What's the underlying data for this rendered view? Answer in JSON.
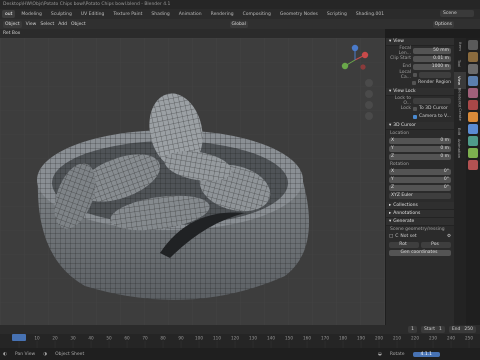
{
  "titlebar": {
    "text": "Desktop\\HW\\Objs\\Potato Chips bowl\\Potato Chips bowl.blend - Blender 4.1"
  },
  "workspaces": [
    "Layout",
    "Modeling",
    "Sculpting",
    "UV Editing",
    "Texture Paint",
    "Shading",
    "Animation",
    "Rendering",
    "Compositing",
    "Geometry Nodes",
    "Scripting",
    "Shading.001"
  ],
  "workspaces_prefix": "out",
  "scene": {
    "label": "Scene"
  },
  "header": {
    "mode": "Object",
    "items": [
      "View",
      "Select",
      "Add",
      "Object"
    ],
    "transform": "Global",
    "options": "Options"
  },
  "tool_header": {
    "items": [
      "Ret Box"
    ]
  },
  "sidebar_tabs": [
    "Item",
    "Tool",
    "View",
    "BlenderKit",
    "Create",
    "Edit",
    "Animation"
  ],
  "sidebar_tab_active": "View",
  "panel": {
    "view_section": "View",
    "focal_label": "Focal Len...",
    "focal_value": "50 mm",
    "clip_start_label": "Clip Start",
    "clip_start_value": "0.01 m",
    "clip_end_label": "End",
    "clip_end_value": "1000 m",
    "local_camera_label": "Local Ca...",
    "render_region_label": "Render Region",
    "view_lock_section": "View Lock",
    "lock_object_label": "Lock to O...",
    "lock_label": "Lock",
    "to_3d_cursor_label": "To 3D Cursor",
    "camera_to_view_label": "Camera to V...",
    "cursor_section": "3D Cursor",
    "location_label": "Location",
    "loc_x_label": "X",
    "loc_x_value": "0 m",
    "loc_y_label": "Y",
    "loc_y_value": "0 m",
    "loc_z_label": "Z",
    "loc_z_value": "0 m",
    "rotation_label": "Rotation",
    "rot_x_label": "X",
    "rot_x_value": "0°",
    "rot_y_label": "Y",
    "rot_y_value": "0°",
    "rot_z_label": "Z",
    "rot_z_value": "0°",
    "rotation_mode": "XYZ Euler",
    "collections_section": "Collections",
    "annotations_section": "Annotations",
    "generate_section": "Generate",
    "scene_gen_label": "Scene geometry/ressing",
    "not_set_label": "Not set",
    "gen_buttons": [
      "Rot",
      "Pos"
    ],
    "gen_coords_label": "Gen coordinates"
  },
  "timeline": {
    "ticks": [
      "0",
      "10",
      "20",
      "30",
      "40",
      "50",
      "60",
      "70",
      "80",
      "90",
      "100",
      "110",
      "120",
      "130",
      "140",
      "150",
      "160",
      "170",
      "180",
      "190",
      "200",
      "210",
      "220",
      "230",
      "240",
      "250"
    ],
    "current_frame": "1",
    "start_label": "Start",
    "start_value": "1",
    "end_label": "End",
    "end_value": "250"
  },
  "status": {
    "left": "Pan View",
    "middle": "Object Sheet",
    "right": "Rotate",
    "version": "4.1.1"
  },
  "colors": {
    "accent": "#4772b3",
    "viewport_bg": "#3d3d3d",
    "mesh": "#8a8f94"
  }
}
